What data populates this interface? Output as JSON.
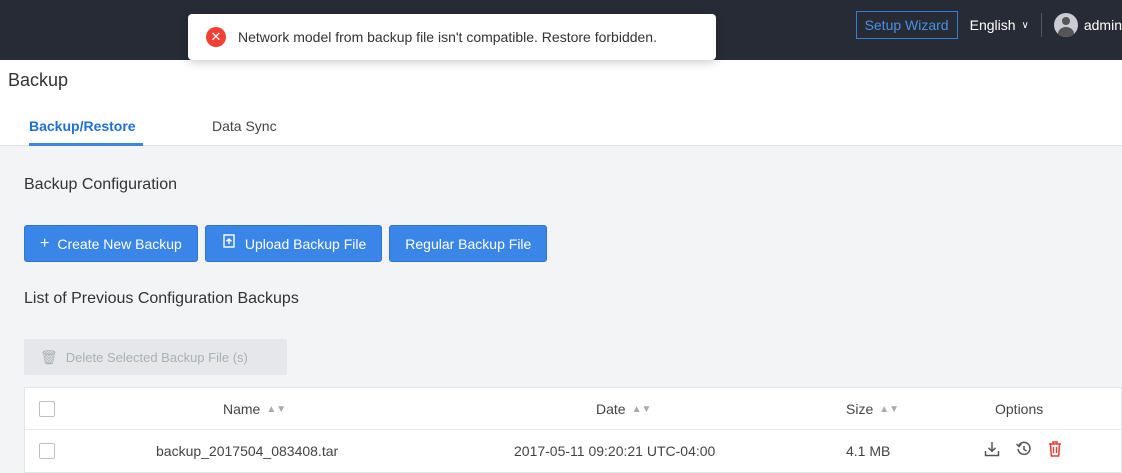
{
  "header": {
    "setup_wizard_label": "Setup Wizard",
    "language_label": "English",
    "user_label": "admin"
  },
  "toast": {
    "message": "Network model from backup file isn't compatible. Restore forbidden."
  },
  "page": {
    "title": "Backup",
    "tabs": [
      {
        "label": "Backup/Restore",
        "active": true
      },
      {
        "label": "Data Sync",
        "active": false
      }
    ]
  },
  "backup_config": {
    "title": "Backup Configuration",
    "create_label": "Create New Backup",
    "upload_label": "Upload Backup File",
    "regular_label": "Regular Backup File"
  },
  "previous_backups": {
    "title": "List of Previous Configuration Backups",
    "delete_label": "Delete Selected Backup File (s)",
    "columns": {
      "name": "Name",
      "date": "Date",
      "size": "Size",
      "options": "Options"
    },
    "rows": [
      {
        "name": "backup_2017504_083408.tar",
        "date": "2017-05-11 09:20:21 UTC-04:00",
        "size": "4.1 MB"
      }
    ]
  },
  "icons": {
    "error": "error-circle-icon",
    "create": "plus-icon",
    "upload": "upload-file-icon",
    "delete": "trash-icon",
    "download": "download-icon",
    "restore": "restore-history-icon",
    "row_delete": "trash-icon"
  },
  "colors": {
    "accent": "#3a86e8",
    "topbar": "#262b36",
    "error": "#f04134"
  }
}
